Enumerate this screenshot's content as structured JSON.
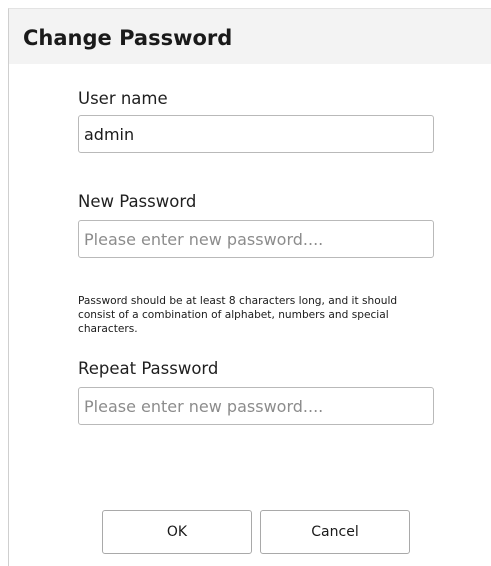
{
  "dialog": {
    "title": "Change Password"
  },
  "form": {
    "username": {
      "label": "User name",
      "value": "admin"
    },
    "new_password": {
      "label": "New Password",
      "placeholder": "Please enter new password...."
    },
    "hint": "Password should be at least 8 characters long, and it should consist of a combination of alphabet, numbers and special characters.",
    "repeat_password": {
      "label": "Repeat Password",
      "placeholder": "Please enter new password...."
    }
  },
  "buttons": {
    "ok_label": "OK",
    "cancel_label": "Cancel"
  }
}
